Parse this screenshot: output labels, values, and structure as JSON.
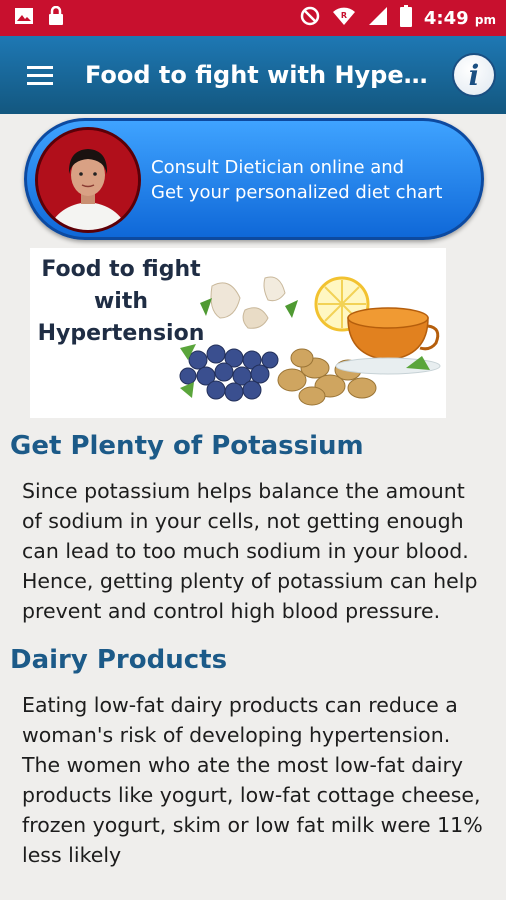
{
  "statusbar": {
    "time": "4:49",
    "ampm": "pm"
  },
  "appbar": {
    "title": "Food to fight with Hypertension"
  },
  "promo": {
    "line1": "Consult Dietician online and",
    "line2": "Get your personalized diet chart"
  },
  "banner": {
    "line1": "Food to fight",
    "line2": "with",
    "line3": "Hypertension"
  },
  "sections": [
    {
      "heading": "Get Plenty of Potassium",
      "text": "Since potassium helps balance the amount of sodium in your cells, not getting enough can lead to too much sodium in your blood. Hence, getting plenty of potassium can help prevent and control high blood pressure."
    },
    {
      "heading": "Dairy Products",
      "text": "Eating low-fat dairy products can reduce a woman's risk of developing hypertension. The women who ate the most low-fat dairy products like yogurt, low-fat cottage cheese, frozen yogurt, skim or low fat milk were 11% less likely"
    }
  ],
  "colors": {
    "statusbar": "#c8102e",
    "appbar": "#1a6aa0",
    "heading": "#1c5a88",
    "promo": "#1f86f0"
  }
}
